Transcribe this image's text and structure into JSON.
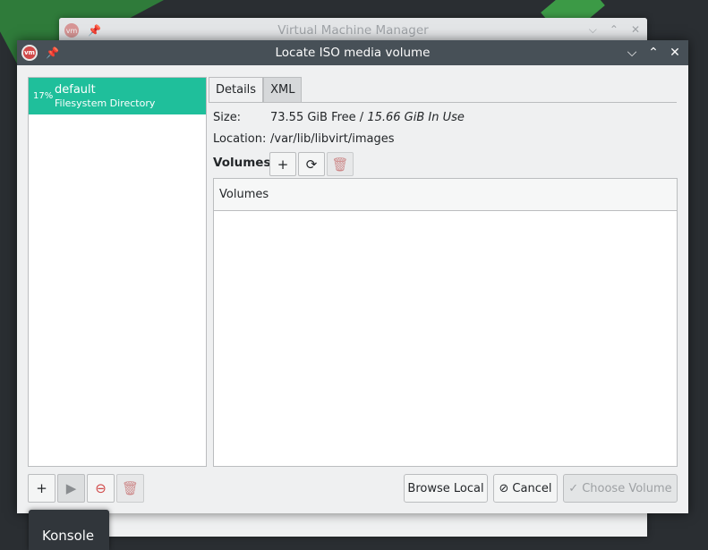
{
  "background_window": {
    "title": "Virtual Machine Manager",
    "icon": "vm",
    "pin": "📌",
    "controls": [
      "⌵",
      "⌃",
      "✕"
    ]
  },
  "dialog": {
    "title": "Locate ISO media volume",
    "app_icon": "vm",
    "pin_glyph": "📌",
    "minimize": "⌵",
    "maximize": "⌃",
    "close": "✕"
  },
  "pools": [
    {
      "percent": "17%",
      "name": "default",
      "type": "Filesystem Directory",
      "selected": true
    }
  ],
  "tabs": [
    {
      "label": "Details",
      "active": true
    },
    {
      "label": "XML",
      "active": false
    }
  ],
  "details": {
    "size_label": "Size:",
    "size_free": "73.55 GiB Free / ",
    "size_used": "15.66 GiB In Use",
    "location_label": "Location:",
    "location_value": "/var/lib/libvirt/images"
  },
  "volumes": {
    "heading": "Volumes",
    "add_glyph": "+",
    "refresh_glyph": "⟳",
    "delete_glyph": "🗑",
    "column_header": "Volumes",
    "rows": []
  },
  "pool_tools": {
    "add_glyph": "+",
    "start_glyph": "▶",
    "stop_glyph": "⊖",
    "delete_glyph": "🗑"
  },
  "buttons": {
    "browse_local": "Browse Local",
    "cancel": "Cancel",
    "cancel_glyph": "⊘",
    "choose_volume": "Choose Volume",
    "choose_glyph": "✓"
  },
  "taskbar": {
    "konsole": "Konsole"
  },
  "colors": {
    "selection": "#1fbf9b",
    "titlebar": "#475057",
    "window_bg": "#eff0f1"
  }
}
